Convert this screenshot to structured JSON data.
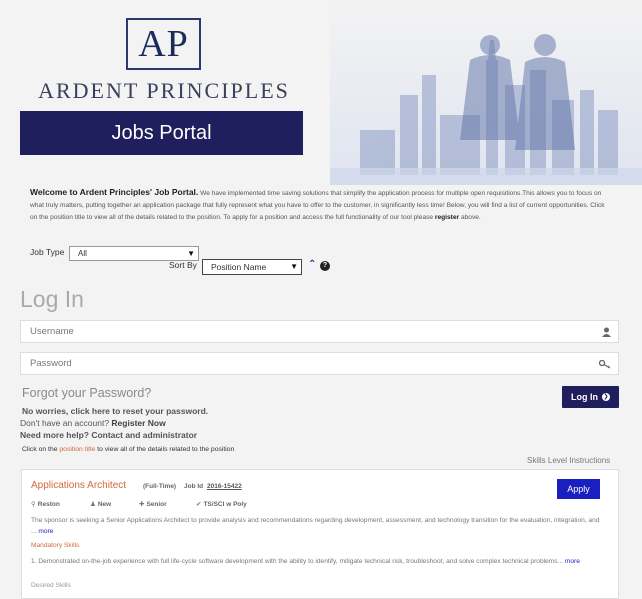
{
  "brand": {
    "logo_letters": "AP",
    "name": "ARDENT PRINCIPLES",
    "portal_title": "Jobs Portal"
  },
  "intro": {
    "lead": "Welcome to Ardent Principles' Job Portal.",
    "body": " We have implemented time saving solutions that simplify the application process for multiple open requisitions.This allows you to focus on what truly matters, putting together an application package that fully represent what you have to offer to the customer, in significantly less time! Below, you will find a list of current opportunities. Click on the position title to view all of the details related to the position. To apply for a position and access the full functionality of our tool please ",
    "register": "register",
    "tail": " above."
  },
  "filters": {
    "job_type_label": "Job Type",
    "job_type_value": "All",
    "sort_by_label": "Sort By",
    "sort_by_value": "Position Name",
    "sort_direction_icon": "sort-ascending-icon",
    "help_icon": "question-circle-icon"
  },
  "login": {
    "title": "Log In",
    "username_placeholder": "Username",
    "password_placeholder": "Password",
    "forgot": "Forgot your Password?",
    "button": "Log In",
    "reset_text": "No worries, click here to reset your password.",
    "no_account": "Don't have an account? ",
    "register_now": "Register Now",
    "more_help": "Need more help? Contact and administrator"
  },
  "hint": {
    "pre": "Click on the ",
    "link": "position title",
    "post": " to view all of the details related to the position"
  },
  "skills_link": "Skills Level Instructions",
  "job": {
    "title": "Applications Architect",
    "type": "(Full-Time)",
    "id_label": "Job Id",
    "id": "2016-15422",
    "apply": "Apply",
    "location": "Reston",
    "status": "New",
    "level": "Senior",
    "clearance": "TS/SCI w Poly",
    "description": "The sponsor is seeking a Senior Applications Architect to provide analysis and recommendations regarding development, assessment, and technology transition for the evaluation, integration, and ... ",
    "more": "more",
    "mandatory_label": "Mandatory Skills",
    "mandatory_skill": "1. Demonstrated on-the-job experience with full life-cycle software development with the ability to identify, mitigate technical risk, troubleshoot, and solve complex technical problems... ",
    "desired_label": "Desired Skills"
  },
  "colors": {
    "navy": "#1e1f5c",
    "accent_orange": "#d16a3a",
    "apply_blue": "#1a1fbf"
  }
}
